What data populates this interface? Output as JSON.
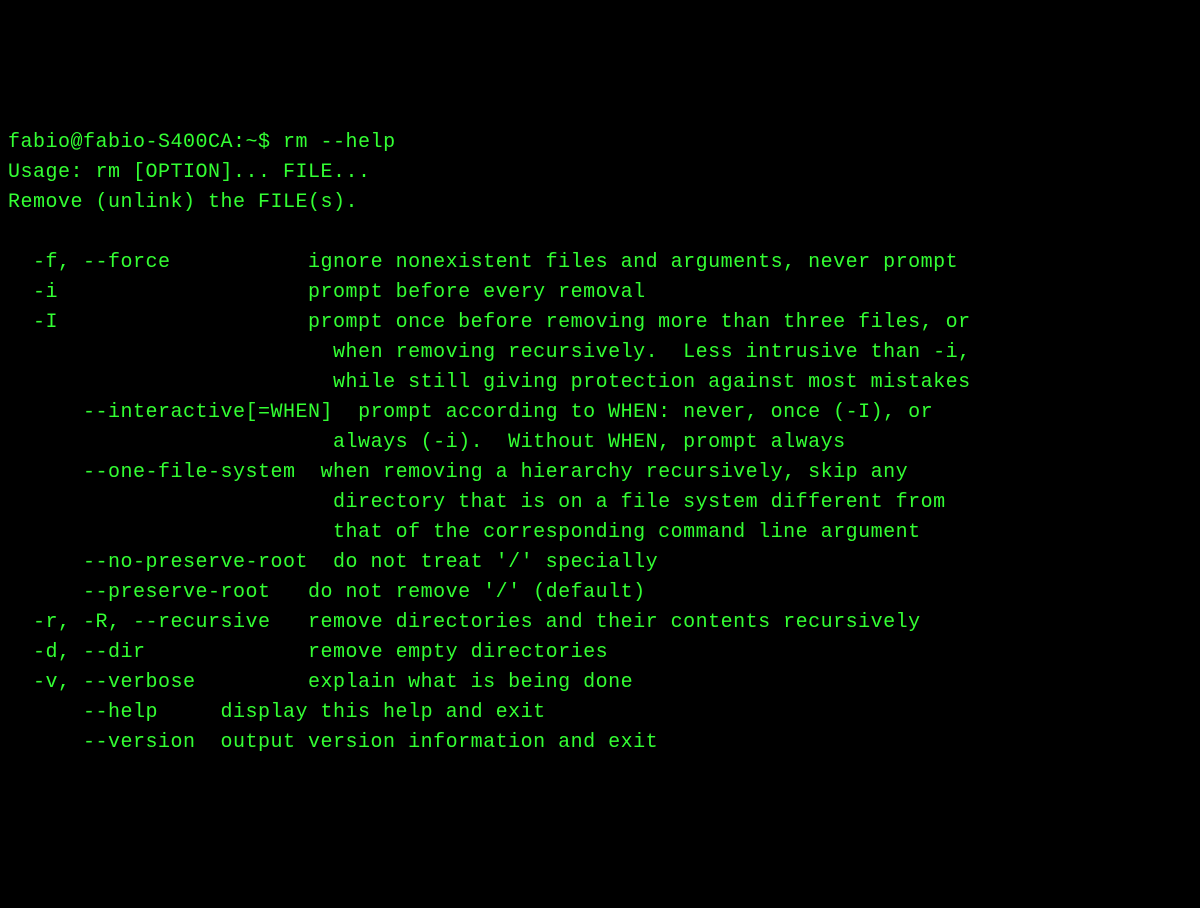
{
  "terminal": {
    "prompt": "fabio@fabio-S400CA:~$ ",
    "command": "rm --help",
    "usage": "Usage: rm [OPTION]... FILE...",
    "description": "Remove (unlink) the FILE(s).",
    "options": [
      {
        "flags": "  -f, --force        ",
        "desc": "   ignore nonexistent files and arguments, never prompt"
      },
      {
        "flags": "  -i                 ",
        "desc": "   prompt before every removal"
      },
      {
        "flags": "  -I                 ",
        "desc": "   prompt once before removing more than three files, or"
      },
      {
        "flags": "                     ",
        "desc": "     when removing recursively.  Less intrusive than -i,"
      },
      {
        "flags": "                     ",
        "desc": "     while still giving protection against most mistakes"
      },
      {
        "flags": "      --interactive[=WHEN]",
        "desc": "  prompt according to WHEN: never, once (-I), or"
      },
      {
        "flags": "                     ",
        "desc": "     always (-i).  Without WHEN, prompt always"
      },
      {
        "flags": "      --one-file-system",
        "desc": "  when removing a hierarchy recursively, skip any"
      },
      {
        "flags": "                     ",
        "desc": "     directory that is on a file system different from"
      },
      {
        "flags": "                     ",
        "desc": "     that of the corresponding command line argument"
      },
      {
        "flags": "      --no-preserve-root",
        "desc": "  do not treat '/' specially"
      },
      {
        "flags": "      --preserve-root ",
        "desc": "  do not remove '/' (default)"
      },
      {
        "flags": "  -r, -R, --recursive",
        "desc": "   remove directories and their contents recursively"
      },
      {
        "flags": "  -d, --dir          ",
        "desc": "   remove empty directories"
      },
      {
        "flags": "  -v, --verbose      ",
        "desc": "   explain what is being done"
      },
      {
        "flags": "      --help    ",
        "desc": " display this help and exit"
      },
      {
        "flags": "      --version ",
        "desc": " output version information and exit"
      }
    ]
  }
}
